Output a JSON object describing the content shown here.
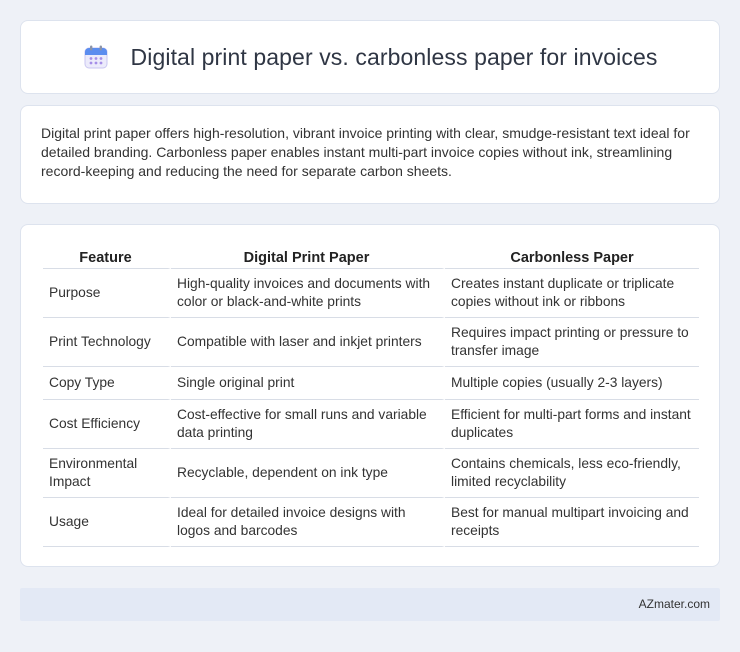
{
  "header": {
    "title": "Digital print paper vs. carbonless paper for invoices",
    "icon": "calendar-icon"
  },
  "intro": {
    "text": "Digital print paper offers high-resolution, vibrant invoice printing with clear, smudge-resistant text ideal for detailed branding. Carbonless paper enables instant multi-part invoice copies without ink, streamlining record-keeping and reducing the need for separate carbon sheets."
  },
  "table": {
    "headers": [
      "Feature",
      "Digital Print Paper",
      "Carbonless Paper"
    ],
    "rows": [
      [
        "Purpose",
        "High-quality invoices and documents with color or black-and-white prints",
        "Creates instant duplicate or triplicate copies without ink or ribbons"
      ],
      [
        "Print Technology",
        "Compatible with laser and inkjet printers",
        "Requires impact printing or pressure to transfer image"
      ],
      [
        "Copy Type",
        "Single original print",
        "Multiple copies (usually 2-3 layers)"
      ],
      [
        "Cost Efficiency",
        "Cost-effective for small runs and variable data printing",
        "Efficient for multi-part forms and instant duplicates"
      ],
      [
        "Environmental Impact",
        "Recyclable, dependent on ink type",
        "Contains chemicals, less eco-friendly, limited recyclability"
      ],
      [
        "Usage",
        "Ideal for detailed invoice designs with logos and barcodes",
        "Best for manual multipart invoicing and receipts"
      ]
    ]
  },
  "footer": {
    "brand": "AZmater.com"
  }
}
